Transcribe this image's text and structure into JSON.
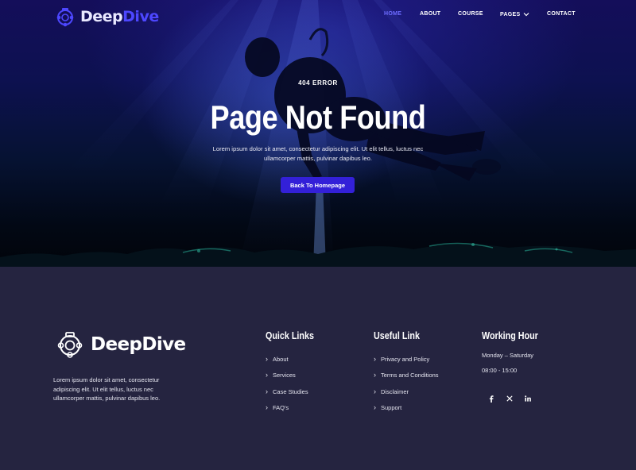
{
  "brand": {
    "name_part1": "Deep",
    "name_part2": "Dive",
    "footer_name": "DeepDive",
    "logo_icon": "diving-helmet-icon",
    "accent_color": "#4d47ff"
  },
  "nav": {
    "items": [
      {
        "label": "HOME",
        "active": true
      },
      {
        "label": "ABOUT",
        "active": false
      },
      {
        "label": "COURSE",
        "active": false
      },
      {
        "label": "PAGES",
        "active": false,
        "has_dropdown": true
      },
      {
        "label": "CONTACT",
        "active": false
      }
    ]
  },
  "hero": {
    "kicker": "404 ERROR",
    "title": "Page Not Found",
    "description": "Lorem ipsum dolor sit amet, consectetur adipiscing elit. Ut elit tellus, luctus nec ullamcorper mattis, pulvinar dapibus leo.",
    "button_label": "Back To Homepage",
    "button_color": "#3320d8"
  },
  "footer": {
    "about": "Lorem ipsum dolor sit amet, consectetur adipiscing elit. Ut elit tellus, luctus nec ullamcorper mattis, pulvinar dapibus leo.",
    "quick_links": {
      "title": "Quick Links",
      "items": [
        "About",
        "Services",
        "Case Studies",
        "FAQ's"
      ]
    },
    "useful_link": {
      "title": "Useful Link",
      "items": [
        "Privacy and Policy",
        "Terms and Conditions",
        "Disclaimer",
        "Support"
      ]
    },
    "working_hour": {
      "title": "Working Hour",
      "days": "Monday – Saturday",
      "hours": "08:00 - 15:00"
    },
    "socials": [
      {
        "icon": "facebook-icon"
      },
      {
        "icon": "x-twitter-icon"
      },
      {
        "icon": "linkedin-icon"
      }
    ],
    "background_color": "#252440"
  }
}
